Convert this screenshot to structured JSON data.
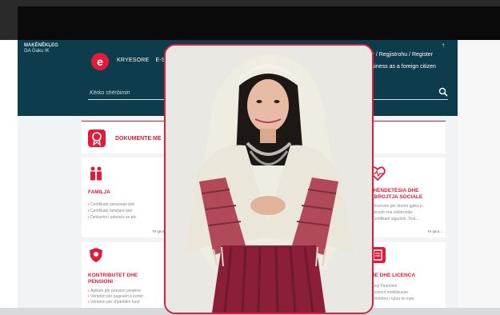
{
  "header": {
    "small_logo_line1": "MAĶĒNĒKĻEG",
    "small_logo_line2": "GA Gaku IK",
    "brand_letter": "e",
    "nav": [
      "KRYESORE",
      "E-SH"
    ],
    "login": "Hyr / Regjistrohu / Register",
    "foreign": "business as a foreign citizen",
    "search_placeholder": "Kërko shërbimin"
  },
  "content": {
    "docs_title": "DOKUMENTE ME",
    "cards": [
      {
        "title": "FAMILJA",
        "items": [
          "Certifikatë personale ipër",
          "Certifikatë familjare ipër",
          "Deklarimi i adresës se ple"
        ],
        "more": "Të tjera..."
      },
      {
        "title": "KONTRIBUTET DHE PENSIONI",
        "items": [
          "Aplikim për pension pleqërie",
          "Vërtetim për pagesën e kontri",
          "Vërtetim për shpërblim fund"
        ],
        "more": ""
      },
      {
        "title": "SHËNDETËSIA DHE MBROJTJA SOCIALE",
        "items": [
          "Rezervim për drurim gjaku p.",
          "Recetë ima elektronike",
          "Certifikatë sigurimit, Test..."
        ],
        "more": "Të tjera..."
      },
      {
        "title": "IDE DHE LICENCA",
        "items": [
          "Lloji Patentimi",
          "Licencë mobilizuese",
          "Vërtetimi i ruhur të rrum"
        ],
        "more": ""
      }
    ]
  },
  "colors": {
    "header_bg": "#0d3c4c",
    "accent": "#e31b3a",
    "content_bg": "#f1f3f4"
  }
}
